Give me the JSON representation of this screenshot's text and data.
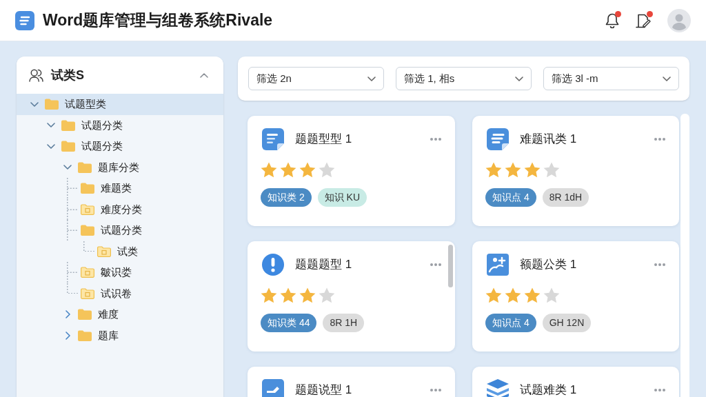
{
  "header": {
    "title": "Word题库管理与组卷系统Rivale",
    "actions": [
      {
        "kind": "bell",
        "unread": true
      },
      {
        "kind": "document",
        "unread": true
      }
    ]
  },
  "sidebar": {
    "title": "试类S",
    "expanded": true,
    "tree": [
      {
        "label": "试题型类",
        "kind": "folder",
        "selected": true,
        "expanded": true,
        "children": [
          {
            "label": "试题分类",
            "kind": "folder",
            "selected": false,
            "expanded": true
          },
          {
            "label": "试题分类",
            "kind": "folder",
            "selected": false,
            "expanded": true,
            "children": [
              {
                "label": "题库分类",
                "kind": "folder",
                "selected": false,
                "expanded": true,
                "children": [
                  {
                    "label": "难题类",
                    "kind": "folder",
                    "selected": false
                  },
                  {
                    "label": "难度分类",
                    "kind": "doc-folder",
                    "selected": false
                  },
                  {
                    "label": "试题分类",
                    "kind": "folder",
                    "selected": false,
                    "children": [
                      {
                        "label": "试类",
                        "kind": "doc-folder",
                        "selected": false
                      }
                    ]
                  },
                  {
                    "label": "皺识娄",
                    "kind": "doc-folder",
                    "selected": false
                  },
                  {
                    "label": "试识卷",
                    "kind": "doc-folder",
                    "selected": false
                  }
                ]
              },
              {
                "label": "难度",
                "kind": "folder",
                "selected": false,
                "expanded": false
              },
              {
                "label": "题库",
                "kind": "folder",
                "selected": false,
                "expanded": false
              }
            ]
          }
        ]
      }
    ]
  },
  "filters": [
    {
      "value": "筛选 2n"
    },
    {
      "value": "筛选 1, 相s"
    },
    {
      "value": "筛选 3l -m"
    }
  ],
  "cards": [
    {
      "kind": "document",
      "title": "题题型型 1",
      "stars": 3,
      "scrollbar": false,
      "tags": [
        {
          "label": "知识类 2",
          "color": "#4b8bc4"
        },
        {
          "label": "知识 KU",
          "color": "#c8ebe5"
        }
      ]
    },
    {
      "kind": "list",
      "title": "难题讯类 1",
      "stars": 3,
      "scrollbar": false,
      "tags": [
        {
          "label": "知识点 4",
          "color": "#4b8bc4"
        },
        {
          "label": "8R 1dH",
          "color": "#dcdcdc"
        }
      ]
    },
    {
      "kind": "alert",
      "title": "题题题型 1",
      "stars": 3,
      "scrollbar": true,
      "tags": [
        {
          "label": "知识类 44",
          "color": "#4b8bc4"
        },
        {
          "label": "8R 1H",
          "color": "#dcdcdc"
        }
      ]
    },
    {
      "kind": "image",
      "title": "额题公类 1",
      "stars": 3,
      "scrollbar": false,
      "tags": [
        {
          "label": "知识点 4",
          "color": "#4b8bc4"
        },
        {
          "label": "GH 12N",
          "color": "#dcdcdc"
        }
      ]
    },
    {
      "kind": "edit",
      "title": "题题说型 1",
      "scrollbar": false
    },
    {
      "kind": "layers",
      "title": "试题难类 1",
      "scrollbar": false
    }
  ]
}
